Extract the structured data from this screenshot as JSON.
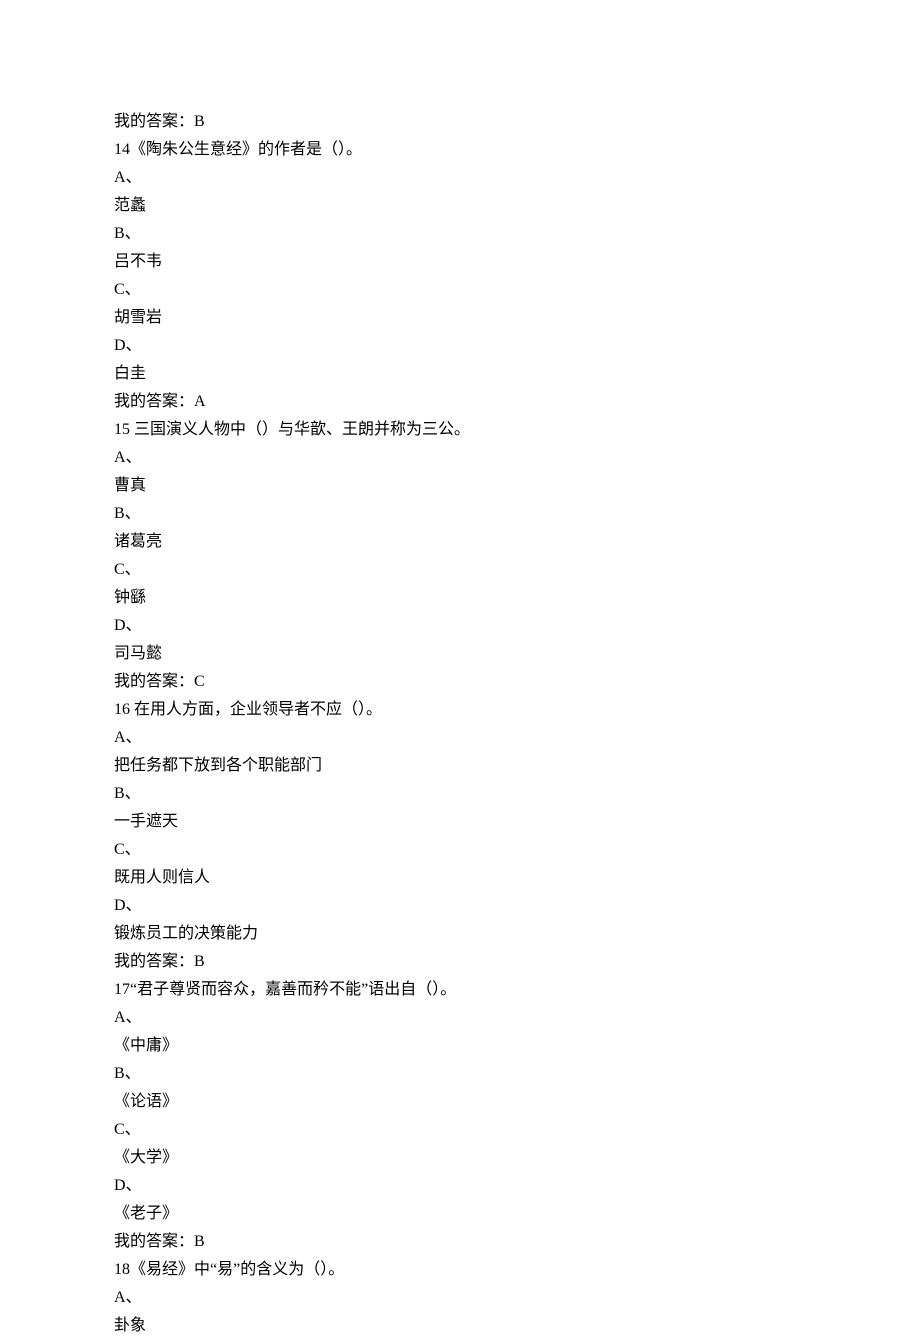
{
  "lines": [
    "我的答案：B",
    "14《陶朱公生意经》的作者是（）。",
    "A、",
    "范蠡",
    "B、",
    "吕不韦",
    "C、",
    "胡雪岩",
    "D、",
    "白圭",
    "我的答案：A",
    "15 三国演义人物中（）与华歆、王朗并称为三公。",
    "A、",
    "曹真",
    "B、",
    "诸葛亮",
    "C、",
    "钟繇",
    "D、",
    "司马懿",
    "我的答案：C",
    "16 在用人方面，企业领导者不应（）。",
    "A、",
    "把任务都下放到各个职能部门",
    "B、",
    "一手遮天",
    "C、",
    "既用人则信人",
    "D、",
    "锻炼员工的决策能力",
    "我的答案：B",
    "17“君子尊贤而容众，嘉善而矜不能”语出自（）。",
    "A、",
    "《中庸》",
    "B、",
    "《论语》",
    "C、",
    "《大学》",
    "D、",
    "《老子》",
    "我的答案：B",
    "18《易经》中“易”的含义为（）。",
    "A、",
    "卦象"
  ]
}
